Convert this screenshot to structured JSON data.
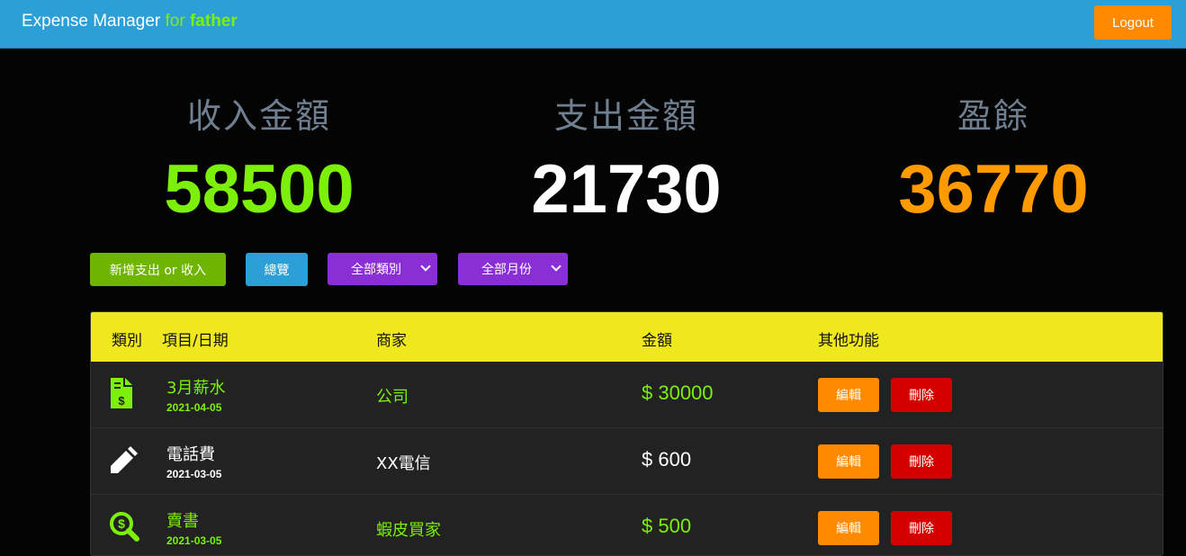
{
  "navbar": {
    "brand_main": "Expense Manager",
    "brand_for": "for",
    "brand_user": "father",
    "logout_label": "Logout"
  },
  "summary": {
    "income_label": "收入金額",
    "income_value": "58500",
    "expense_label": "支出金額",
    "expense_value": "21730",
    "balance_label": "盈餘",
    "balance_value": "36770"
  },
  "toolbar": {
    "add_label": "新增支出 or 收入",
    "overview_label": "總覽",
    "category_select": "全部類別",
    "month_select": "全部月份"
  },
  "table": {
    "headers": {
      "category": "類別",
      "item_date": "項目/日期",
      "merchant": "商家",
      "amount": "金額",
      "actions": "其他功能"
    },
    "rows": [
      {
        "icon": "invoice-dollar-icon",
        "title": "3月薪水",
        "date": "2021-04-05",
        "merchant": "公司",
        "amount": "$ 30000",
        "type": "income",
        "edit": "編輯",
        "delete": "刪除"
      },
      {
        "icon": "pencil-icon",
        "title": "電話費",
        "date": "2021-03-05",
        "merchant": "XX電信",
        "amount": "$ 600",
        "type": "expense",
        "edit": "編輯",
        "delete": "刪除"
      },
      {
        "icon": "search-dollar-icon",
        "title": "賣書",
        "date": "2021-03-05",
        "merchant": "蝦皮買家",
        "amount": "$ 500",
        "type": "income",
        "edit": "編輯",
        "delete": "刪除"
      }
    ]
  },
  "colors": {
    "navbar": "#2b9fd6",
    "income": "#7cf00a",
    "expense": "#ffffff",
    "balance": "#ff9a00",
    "header": "#f0e81e",
    "add_button": "#6fb400",
    "overview_button": "#2b9fd6",
    "select": "#8a2ed6",
    "edit_button": "#ff8a00",
    "delete_button": "#d40000"
  }
}
